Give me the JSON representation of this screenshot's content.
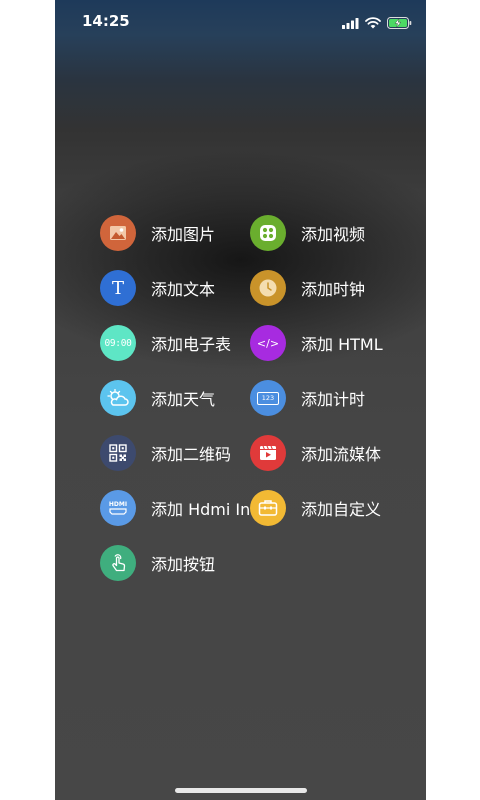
{
  "status_bar": {
    "time": "14:25"
  },
  "menu": {
    "left_column": [
      {
        "id": "image",
        "label": "添加图片",
        "icon": "image-icon",
        "color": "#d0653b"
      },
      {
        "id": "text",
        "label": "添加文本",
        "icon": "text-icon",
        "color": "#2f6fd4",
        "glyph": "T"
      },
      {
        "id": "clock-display",
        "label": "添加电子表",
        "icon": "digital-clock-icon",
        "color": "#5ee6c5",
        "glyph": "09:00"
      },
      {
        "id": "weather",
        "label": "添加天气",
        "icon": "weather-icon",
        "color": "#5cc4ee"
      },
      {
        "id": "qrcode",
        "label": "添加二维码",
        "icon": "qrcode-icon",
        "color": "#3d4a6e"
      },
      {
        "id": "hdmi",
        "label": "添加 Hdmi In",
        "icon": "hdmi-icon",
        "color": "#5a9ae6",
        "glyph": "HDMI"
      },
      {
        "id": "button",
        "label": "添加按钮",
        "icon": "touch-button-icon",
        "color": "#3fae7e"
      }
    ],
    "right_column": [
      {
        "id": "video",
        "label": "添加视频",
        "icon": "video-icon",
        "color": "#6aae2e"
      },
      {
        "id": "analog-clock",
        "label": "添加时钟",
        "icon": "analog-clock-icon",
        "color": "#c9932a"
      },
      {
        "id": "html",
        "label": "添加 HTML",
        "icon": "code-icon",
        "color": "#a72be0",
        "glyph": "</>"
      },
      {
        "id": "timer",
        "label": "添加计时",
        "icon": "timer-icon",
        "color": "#4b8ee0",
        "glyph": "123"
      },
      {
        "id": "stream",
        "label": "添加流媒体",
        "icon": "streaming-icon",
        "color": "#e03a3a"
      },
      {
        "id": "custom",
        "label": "添加自定义",
        "icon": "toolbox-icon",
        "color": "#f2b934"
      }
    ]
  }
}
